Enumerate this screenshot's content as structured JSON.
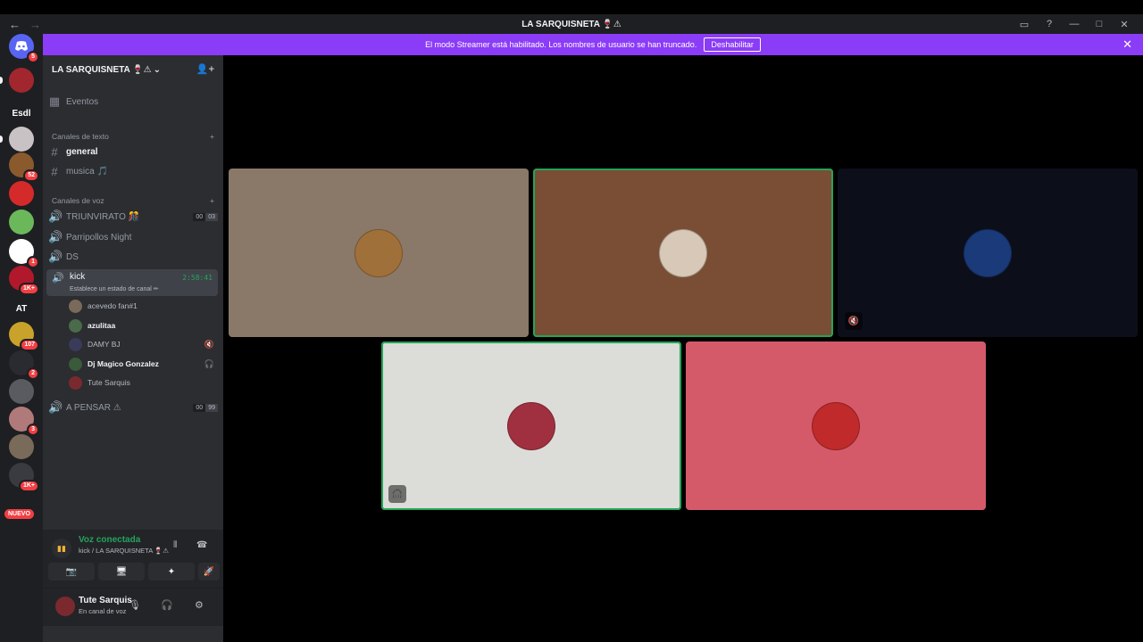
{
  "window": {
    "title": "LA SARQUISNETA 🍷⚠",
    "nav_back": "←",
    "nav_forward": "→",
    "controls": [
      "▭",
      "?",
      "—",
      "□",
      "✕"
    ]
  },
  "banner": {
    "text": "El modo Streamer está habilitado. Los nombres de usuario se han truncado.",
    "button_label": "Deshabilitar",
    "close": "✕"
  },
  "rail": {
    "dm_badge": "5",
    "servers": [
      {
        "label": "",
        "badge": "",
        "color": "#a2262e"
      },
      {
        "label": "Esdl",
        "badge": "",
        "color": "#1e1f22"
      },
      {
        "label": "",
        "badge": "",
        "color": "#c9c2c4"
      },
      {
        "label": "",
        "badge": "52",
        "color": "#8a5a2c"
      },
      {
        "label": "",
        "badge": "",
        "color": "#d42a2a"
      },
      {
        "label": "",
        "badge": "",
        "color": "#6bb85a"
      },
      {
        "label": "",
        "badge": "1",
        "color": "#ffffff"
      },
      {
        "label": "",
        "badge": "1K+",
        "color": "#b2182b"
      },
      {
        "label": "AT",
        "badge": "",
        "color": "#1e1f22"
      },
      {
        "label": "",
        "badge": "107",
        "color": "#c8a22a"
      },
      {
        "label": "",
        "badge": "2",
        "color": "#2a2b30"
      },
      {
        "label": "",
        "badge": "",
        "color": "#5a5b60"
      },
      {
        "label": "",
        "badge": "3",
        "color": "#b07a7a"
      },
      {
        "label": "",
        "badge": "",
        "color": "#7a6a5a"
      },
      {
        "label": "",
        "badge": "1K+",
        "color": "#3a3b40"
      }
    ],
    "new_label": "NUEVO"
  },
  "sidebar": {
    "server_name": "LA SARQUISNETA 🍷⚠",
    "header_chevron": "⌄",
    "events": "Eventos",
    "text_category": "Canales de texto",
    "text_channels": [
      {
        "name": "general"
      },
      {
        "name": "musica 🎵"
      }
    ],
    "voice_category": "Canales de voz",
    "voice_channels": [
      {
        "name": "TRIUNVIRATO 🎊",
        "count_a": "00",
        "count_b": "03"
      },
      {
        "name": "Parripollos Night"
      },
      {
        "name": "DS"
      }
    ],
    "active_channel": {
      "name": "kick",
      "status": "Establece un estado de canal ✏",
      "timer": "2:58:41"
    },
    "members": [
      {
        "name": "acevedo fan#1",
        "color": "#7a6a5a",
        "icon": ""
      },
      {
        "name": "azulitaa",
        "color": "#4a6a4a",
        "icon": ""
      },
      {
        "name": "DAMY BJ",
        "color": "#3a3a5a",
        "icon": "🔇"
      },
      {
        "name": "Dj Magico Gonzalez",
        "color": "#3a5a3a",
        "icon": "🎧"
      },
      {
        "name": "Tute Sarquis",
        "color": "#7a2a2e",
        "icon": ""
      }
    ],
    "last_channel": {
      "name": "A PENSAR ⚠",
      "count_a": "00",
      "count_b": "99"
    }
  },
  "voice": {
    "status": "Voz conectada",
    "location": "kick / LA SARQUISNETA 🍷⚠",
    "buttons": [
      "📷",
      "🖥",
      "✦",
      "🚀"
    ]
  },
  "user": {
    "name": "Tute Sarquis",
    "sub": "En canal de voz"
  },
  "tiles": [
    {
      "bg": "#8a7868",
      "avatar": "#a0703a",
      "speaking": false,
      "badge": ""
    },
    {
      "bg": "#7a4e34",
      "avatar": "#d8c8b8",
      "speaking": true,
      "badge": ""
    },
    {
      "bg": "#0c0f1a",
      "avatar": "#1a3a7a",
      "speaking": false,
      "badge": "🔇"
    },
    {
      "bg": "#dcdcd8",
      "avatar": "#a03040",
      "speaking": true,
      "badge": "🎧"
    },
    {
      "bg": "#d45a6a",
      "avatar": "#c02a2a",
      "speaking": false,
      "badge": ""
    }
  ]
}
